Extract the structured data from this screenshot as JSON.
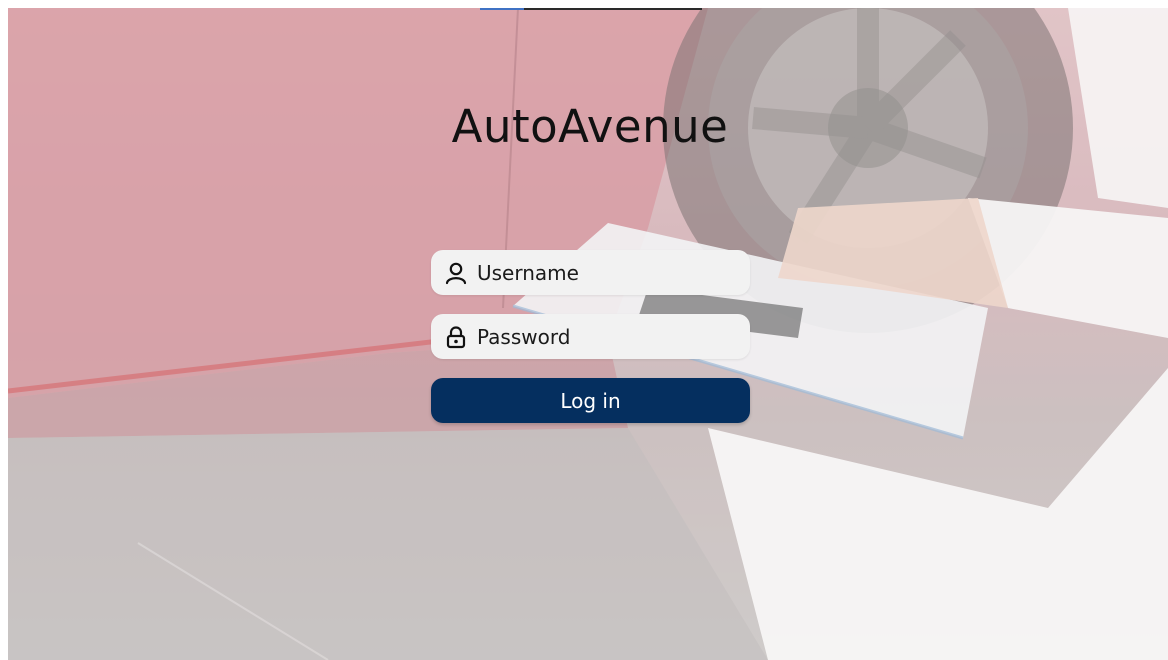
{
  "app": {
    "title": "AutoAvenue"
  },
  "form": {
    "username_placeholder": "Username",
    "password_placeholder": "Password",
    "login_label": "Log in"
  },
  "icons": {
    "username": "user-icon",
    "password": "lock-icon"
  },
  "colors": {
    "button_bg": "#052f5f",
    "field_bg": "#f2f2f2",
    "top_line_accent": "#3f72c4"
  }
}
